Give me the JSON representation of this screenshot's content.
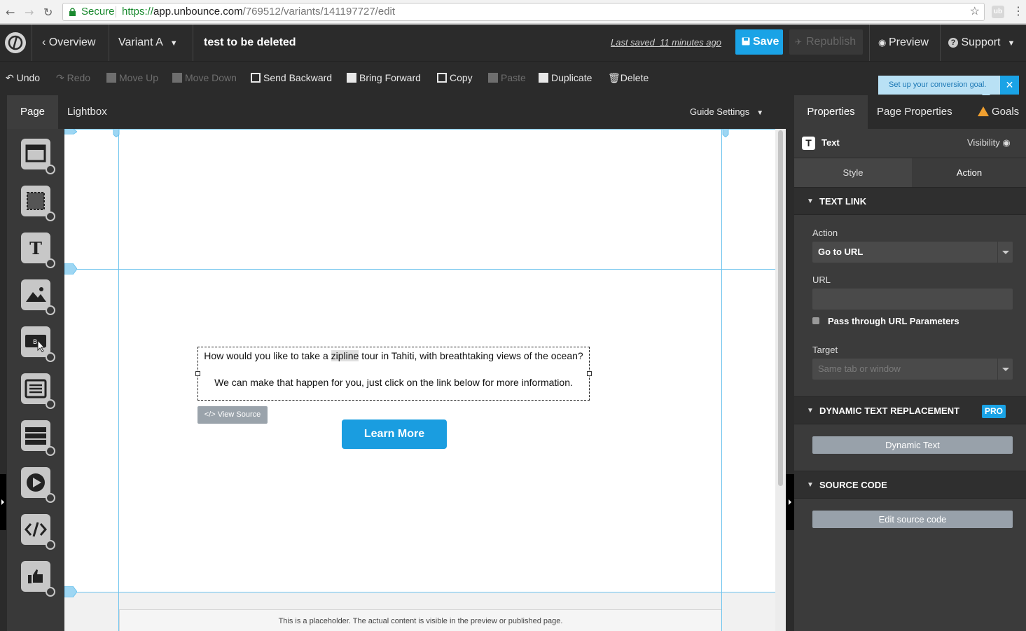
{
  "browser": {
    "secure_label": "Secure",
    "url_scheme": "https://",
    "url_host": "app.unbounce.com",
    "url_path": "/769512/variants/141197727/edit",
    "ext_label": "ub"
  },
  "appbar": {
    "overview_label": "Overview",
    "variant_label": "Variant A",
    "page_title": "test to be deleted",
    "last_saved": "Last saved  11 minutes ago",
    "save_label": "Save",
    "republish_label": "Republish",
    "preview_label": "Preview",
    "support_label": "Support"
  },
  "toolbar": {
    "undo": "Undo",
    "redo": "Redo",
    "move_up": "Move Up",
    "move_down": "Move Down",
    "send_backward": "Send Backward",
    "bring_forward": "Bring Forward",
    "copy": "Copy",
    "paste": "Paste",
    "duplicate": "Duplicate",
    "delete": "Delete"
  },
  "goal_tip": {
    "text": "Set up your conversion goal.",
    "close": "✕"
  },
  "canvas_tabs": {
    "page": "Page",
    "lightbox": "Lightbox",
    "guide_settings": "Guide Settings"
  },
  "palette": {
    "widgets": [
      "section-widget",
      "box-widget",
      "text-widget",
      "image-widget",
      "button-widget",
      "form-widget",
      "social-widget",
      "video-widget",
      "custom-html-widget",
      "social-like-widget"
    ]
  },
  "canvas": {
    "text_line1_before": "How would you like to take a ",
    "text_line1_highlight": "zipline",
    "text_line1_after": " tour in Tahiti, with breathtaking views of the ocean?",
    "text_line2": "We can make that happen for you, just click on the link below for more information.",
    "view_source": "</> View Source",
    "button_label": "Learn More",
    "footer_placeholder": "This is a placeholder. The actual content is visible in the preview or published page."
  },
  "panel": {
    "tab_properties": "Properties",
    "tab_page_properties": "Page Properties",
    "tab_goals": "Goals",
    "selected_type_icon": "T",
    "selected_name": "Text",
    "visibility_label": "Visibility",
    "subtab_style": "Style",
    "subtab_action": "Action",
    "section_text_link": "TEXT LINK",
    "action_label": "Action",
    "action_value": "Go to URL",
    "url_label": "URL",
    "url_value": "",
    "pass_params_label": "Pass through URL Parameters",
    "target_label": "Target",
    "target_value": "Same tab or window",
    "section_dtr": "DYNAMIC TEXT REPLACEMENT",
    "pro_badge": "PRO",
    "dynamic_text_button": "Dynamic Text",
    "section_source": "SOURCE CODE",
    "edit_source_button": "Edit source code"
  },
  "colors": {
    "accent": "#1aa3e6",
    "dark_bar": "#2b2b2b",
    "panel": "#3b3b3b",
    "guide": "#6ec4ee",
    "secure_green": "#1a8a2f",
    "warning": "#f0a030"
  }
}
